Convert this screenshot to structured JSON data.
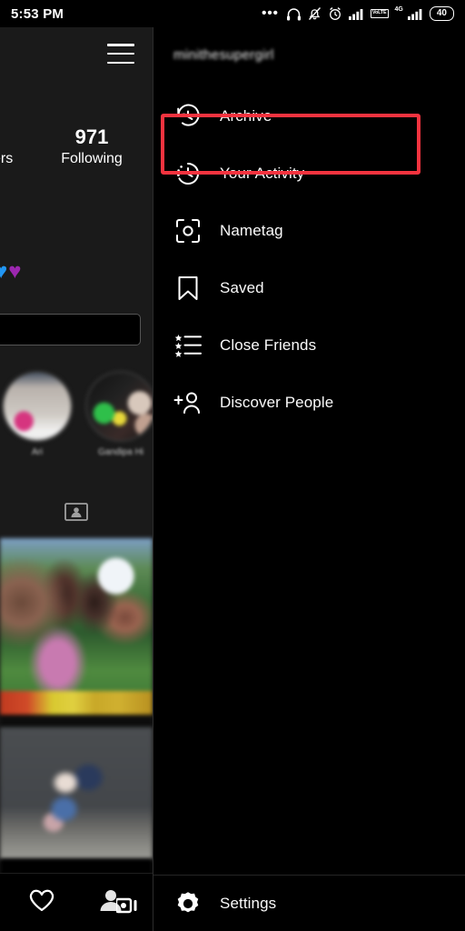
{
  "status_bar": {
    "time": "5:53 PM",
    "icons": [
      {
        "name": "more-dots-icon",
        "glyph": "•••"
      },
      {
        "name": "headphones-icon"
      },
      {
        "name": "notifications-muted-icon"
      },
      {
        "name": "alarm-clock-icon"
      },
      {
        "name": "signal-bars-icon"
      },
      {
        "name": "volte-icon"
      },
      {
        "name": "4g-signal-icon"
      },
      {
        "name": "battery-icon"
      }
    ],
    "volte_top": "Vo",
    "volte_bottom": "LTE",
    "network_label": "4G",
    "battery_level": "40"
  },
  "profile_panel": {
    "menu_button_label": "Menu",
    "followers_partial_label": "ers",
    "following_count": "971",
    "following_label": "Following",
    "bio_emoji_blue": "♥",
    "bio_emoji_purple": "♥",
    "edit_profile_label": "",
    "highlights": [
      {
        "name": "Ari"
      },
      {
        "name": "Gandipa Hi"
      }
    ],
    "tabs": [
      {
        "name": "tagged-photos-tab"
      }
    ],
    "nav": [
      {
        "name": "activity-heart-icon"
      },
      {
        "name": "profile-person-icon"
      }
    ]
  },
  "drawer": {
    "username": "minithesupergirl",
    "items": [
      {
        "label": "Archive",
        "icon": "archive-clock-icon",
        "highlighted": true
      },
      {
        "label": "Your Activity",
        "icon": "activity-clock-icon",
        "highlighted": false
      },
      {
        "label": "Nametag",
        "icon": "nametag-scan-icon",
        "highlighted": false
      },
      {
        "label": "Saved",
        "icon": "bookmark-icon",
        "highlighted": false
      },
      {
        "label": "Close Friends",
        "icon": "star-list-icon",
        "highlighted": false
      },
      {
        "label": "Discover People",
        "icon": "person-add-icon",
        "highlighted": false
      }
    ],
    "footer": {
      "label": "Settings",
      "icon": "gear-icon"
    },
    "highlight_color": "#f5333f"
  }
}
